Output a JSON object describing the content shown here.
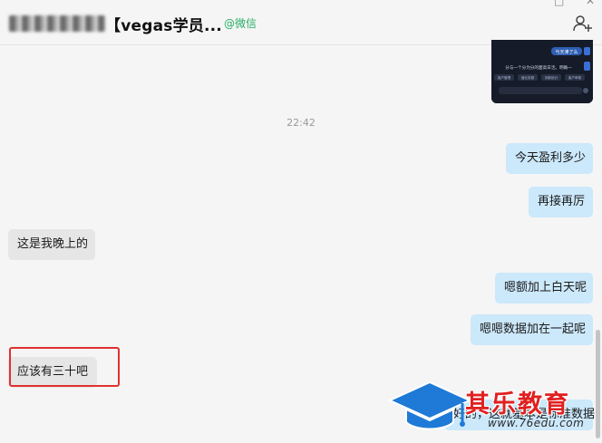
{
  "window": {
    "minimize_glyph": "□",
    "close_glyph": "✕"
  },
  "header": {
    "title": "【vegas学员...",
    "source_tag": "@微信",
    "add_member_icon": "add-user-icon"
  },
  "media_preview": {
    "caption_right": "与天津了么",
    "caption_main": "分与一个分为分的面高日活。明确一",
    "chips": [
      "客户管理",
      "营业执照",
      "到款统计",
      "客户审核"
    ]
  },
  "timestamp": "22:42",
  "messages": [
    {
      "direction": "out",
      "text": "今天盈利多少"
    },
    {
      "direction": "out",
      "text": "再接再厉"
    },
    {
      "direction": "in",
      "text": "这是我晚上的"
    },
    {
      "direction": "out",
      "text": "嗯额加上白天呢"
    },
    {
      "direction": "out",
      "text": "嗯嗯数据加在一起呢"
    },
    {
      "direction": "in",
      "text": "应该有三十吧"
    },
    {
      "direction": "out",
      "text": "好的，这就基本是标准数据"
    }
  ],
  "watermark": {
    "brand": "其乐教育",
    "url": "www.76edu.com"
  },
  "colors": {
    "outgoing_bubble": "#cce8fb",
    "incoming_bubble": "#e6e6e6",
    "wechat_green": "#2aae67",
    "highlight_red": "#e23030",
    "watermark_blue": "#1e7ad6",
    "watermark_red": "#e02020"
  }
}
